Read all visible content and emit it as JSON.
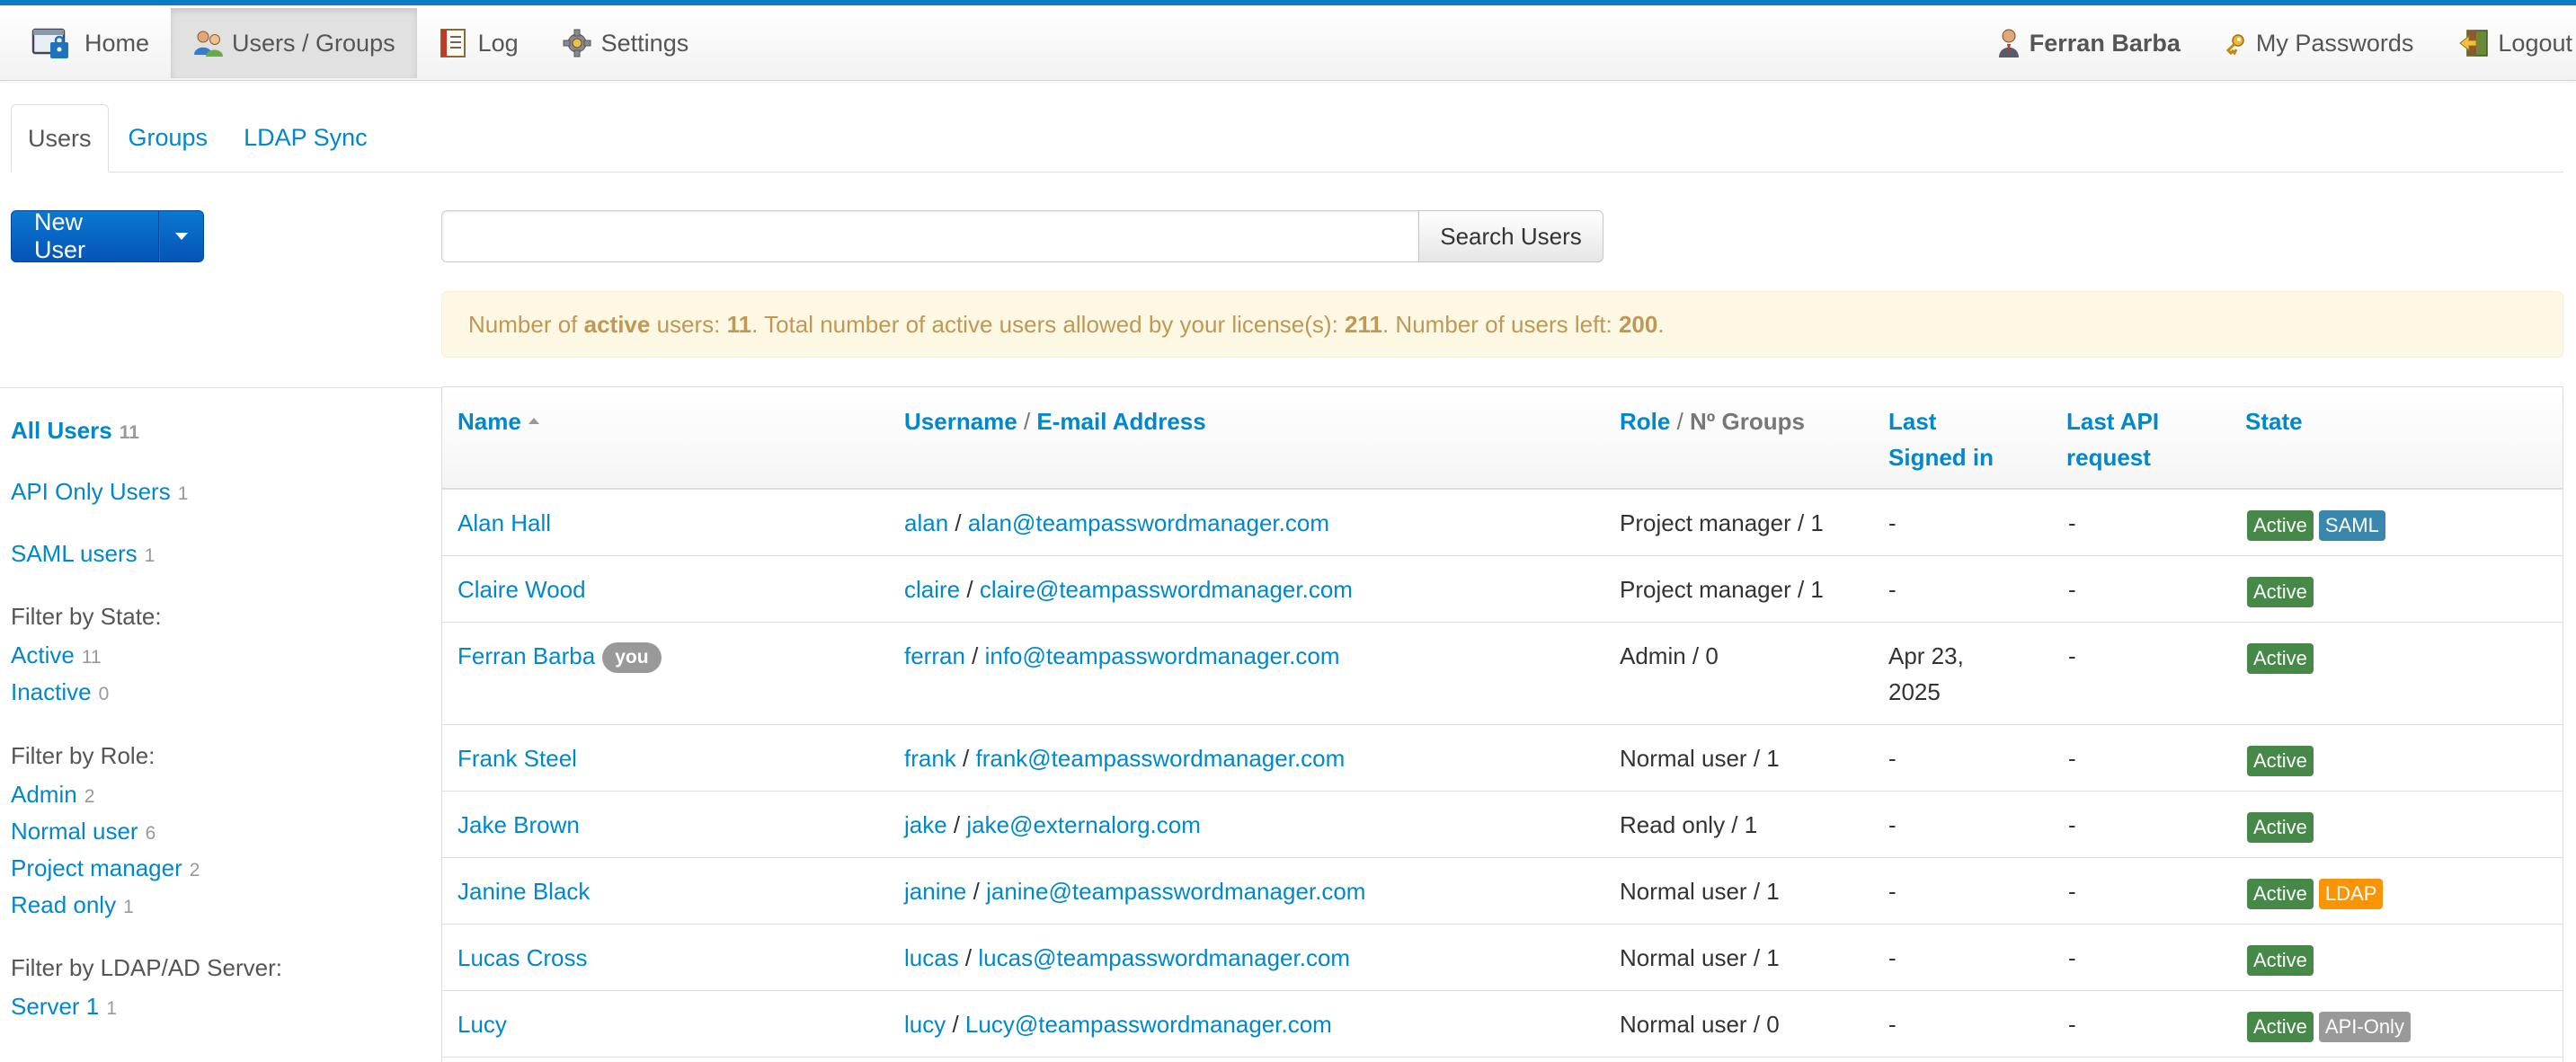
{
  "nav": {
    "home": "Home",
    "users_groups": "Users / Groups",
    "log": "Log",
    "settings": "Settings",
    "user_name": "Ferran Barba",
    "my_passwords": "My Passwords",
    "logout": "Logout"
  },
  "tabs": [
    {
      "label": "Users",
      "active": true
    },
    {
      "label": "Groups",
      "active": false
    },
    {
      "label": "LDAP Sync",
      "active": false
    }
  ],
  "new_user_label": "New User",
  "search": {
    "placeholder": "",
    "value": "",
    "button": "Search Users"
  },
  "alert": {
    "p1": "Number of ",
    "active_word": "active",
    "p2": " users: ",
    "active_count": "11",
    "p3": ". Total number of active users allowed by your license(s): ",
    "allowed": "211",
    "p4": ". Number of users left: ",
    "left": "200",
    "p5": "."
  },
  "sidebar": {
    "all_users": {
      "label": "All Users",
      "count": "11"
    },
    "api_only": {
      "label": "API Only Users",
      "count": "1"
    },
    "saml": {
      "label": "SAML users",
      "count": "1"
    },
    "state_heading": "Filter by State:",
    "states": [
      {
        "label": "Active",
        "count": "11"
      },
      {
        "label": "Inactive",
        "count": "0"
      }
    ],
    "role_heading": "Filter by Role:",
    "roles": [
      {
        "label": "Admin",
        "count": "2"
      },
      {
        "label": "Normal user",
        "count": "6"
      },
      {
        "label": "Project manager",
        "count": "2"
      },
      {
        "label": "Read only",
        "count": "1"
      }
    ],
    "ldap_heading": "Filter by LDAP/AD Server:",
    "ldap_servers": [
      {
        "label": "Server 1",
        "count": "1"
      }
    ]
  },
  "table": {
    "headers": {
      "name": "Name",
      "username": "Username",
      "slash": " / ",
      "email": "E-mail Address",
      "role": "Role",
      "groups": "Nº Groups",
      "last_signed_1": "Last",
      "last_signed_2": "Signed in",
      "last_api_1": "Last API",
      "last_api_2": "request",
      "state": "State"
    },
    "you_badge": "you",
    "rows": [
      {
        "name": "Alan Hall",
        "you": false,
        "username": "alan",
        "email": "alan@teampasswordmanager.com",
        "role": "Project manager / 1",
        "last_signed": "-",
        "last_signed_2": "",
        "last_api": "-",
        "labels": [
          {
            "text": "Active",
            "color": "#468847"
          },
          {
            "text": "SAML",
            "color": "#3a87ad"
          }
        ]
      },
      {
        "name": "Claire Wood",
        "you": false,
        "username": "claire",
        "email": "claire@teampasswordmanager.com",
        "role": "Project manager / 1",
        "last_signed": "-",
        "last_signed_2": "",
        "last_api": "-",
        "labels": [
          {
            "text": "Active",
            "color": "#468847"
          }
        ]
      },
      {
        "name": "Ferran Barba",
        "you": true,
        "username": "ferran",
        "email": "info@teampasswordmanager.com",
        "role": "Admin / 0",
        "last_signed": "Apr 23,",
        "last_signed_2": "2025",
        "last_api": "-",
        "labels": [
          {
            "text": "Active",
            "color": "#468847"
          }
        ]
      },
      {
        "name": "Frank Steel",
        "you": false,
        "username": "frank",
        "email": "frank@teampasswordmanager.com",
        "role": "Normal user / 1",
        "last_signed": "-",
        "last_signed_2": "",
        "last_api": "-",
        "labels": [
          {
            "text": "Active",
            "color": "#468847"
          }
        ]
      },
      {
        "name": "Jake Brown",
        "you": false,
        "username": "jake",
        "email": "jake@externalorg.com",
        "role": "Read only / 1",
        "last_signed": "-",
        "last_signed_2": "",
        "last_api": "-",
        "labels": [
          {
            "text": "Active",
            "color": "#468847"
          }
        ]
      },
      {
        "name": "Janine Black",
        "you": false,
        "username": "janine",
        "email": "janine@teampasswordmanager.com",
        "role": "Normal user / 1",
        "last_signed": "-",
        "last_signed_2": "",
        "last_api": "-",
        "labels": [
          {
            "text": "Active",
            "color": "#468847"
          },
          {
            "text": "LDAP",
            "color": "#f89406"
          }
        ]
      },
      {
        "name": "Lucas Cross",
        "you": false,
        "username": "lucas",
        "email": "lucas@teampasswordmanager.com",
        "role": "Normal user / 1",
        "last_signed": "-",
        "last_signed_2": "",
        "last_api": "-",
        "labels": [
          {
            "text": "Active",
            "color": "#468847"
          }
        ]
      },
      {
        "name": "Lucy",
        "you": false,
        "username": "lucy",
        "email": "Lucy@teampasswordmanager.com",
        "role": "Normal user / 0",
        "last_signed": "-",
        "last_signed_2": "",
        "last_api": "-",
        "labels": [
          {
            "text": "Active",
            "color": "#468847"
          },
          {
            "text": "API-Only",
            "color": "#999999"
          }
        ]
      }
    ]
  }
}
